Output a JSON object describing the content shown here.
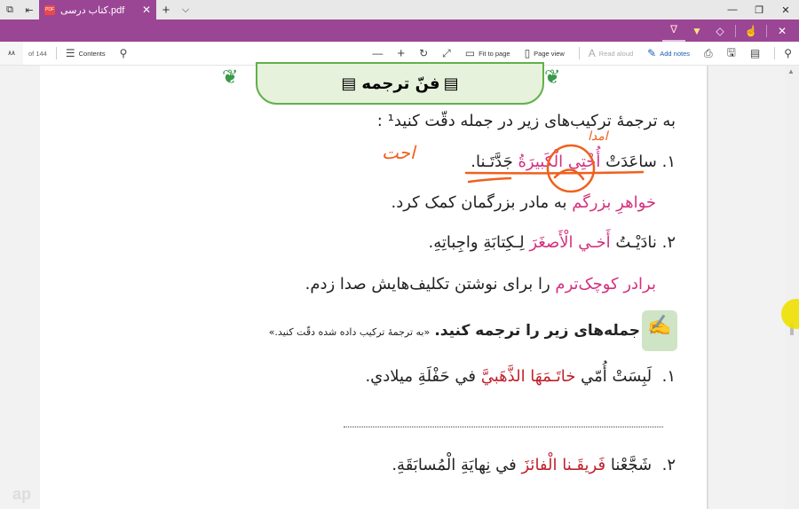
{
  "tabbar": {
    "tab_title": "کتاب درسی.pdf",
    "pdf_icon": "PDF",
    "close": "✕",
    "new_tab": "+",
    "dropdown": "⌵"
  },
  "window": {
    "minimize": "—",
    "restore": "❐",
    "close": "✕"
  },
  "pen_toolbar": {
    "icons": [
      "draw-icon",
      "highlight-icon",
      "erase-icon",
      "touch-write-icon",
      "close-icon"
    ]
  },
  "toolbar": {
    "page_number": "۸۸",
    "page_total": "of 144",
    "contents": "Contents",
    "fit_to_page": "Fit to page",
    "page_view": "Page view",
    "read_aloud": "Read aloud",
    "add_notes": "Add notes"
  },
  "document": {
    "section_title": "فنّ ترجمه",
    "instruction": "به ترجمهٔ ترکیب‌های زیر در جمله دقّت کنید¹ :",
    "ex1": {
      "num": "۱.",
      "pre": "ساعَدَتْ",
      "hl": "أُخْتِي الْکَبیرَةُ",
      "post": "جَدَّتَـنا."
    },
    "ex1_tr": {
      "hl": "خواهرِ بزرگم",
      "post": "به مادر بزرگمان کمک کرد."
    },
    "ex2": {
      "num": "۲.",
      "pre": "نادَیْـتُ",
      "hl": "أَخـي الْأَصغَرَ",
      "post": "لِـکِتابَةِ واجِباتِهِ."
    },
    "ex2_tr": {
      "hl": "برادر کوچک‌ترم",
      "post": "را برای نوشتن تکلیف‌هایش صدا زدم."
    },
    "task": {
      "bold": "جمله‌های زیر را ترجمه کنید.",
      "note": "«به ترجمهٔ ترکیب داده شده دقّت کنید.»"
    },
    "q1": {
      "num": "۱.",
      "pre": "لَبِسَتْ أُمّي",
      "hl": "خاتَـمَهَا الذَّهَبيَّ",
      "post": "في حَفْلَةِ ميلادي."
    },
    "q2": {
      "num": "۲.",
      "pre": "شَجَّعْنا",
      "hl": "فَریقَـنا الْفائزَ",
      "post": "في نِهايَةِ الْمُسابَقَةِ."
    },
    "handwriting": [
      "احت",
      "امدا"
    ]
  },
  "watermark": "ap"
}
